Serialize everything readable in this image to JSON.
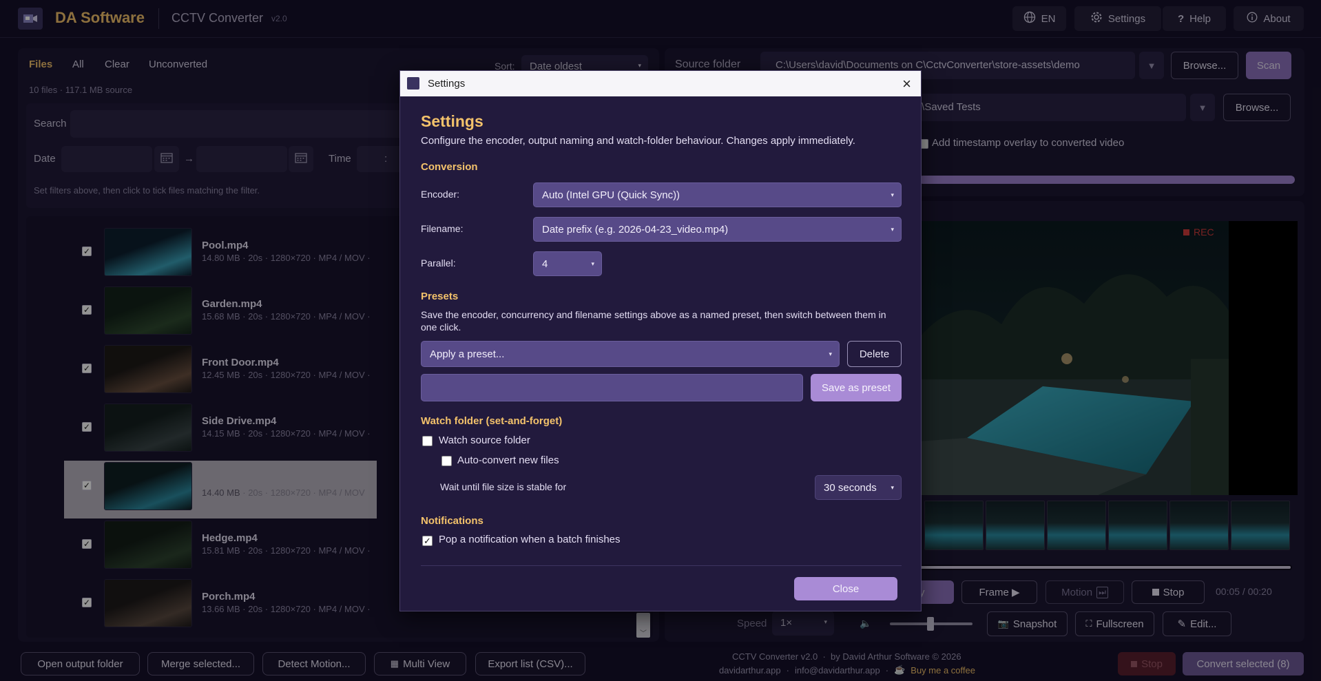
{
  "app": {
    "brand": "DA Software",
    "title": "CCTV Converter",
    "version": "v2.0"
  },
  "topbar": {
    "lang": "EN",
    "settings": "Settings",
    "help": "Help",
    "about": "About"
  },
  "left": {
    "tabs": {
      "files": "Files",
      "all": "All",
      "clear": "Clear",
      "unconverted": "Unconverted"
    },
    "sort_label": "Sort:",
    "sort_value": "Date oldest",
    "summary": "10 files · 117.1 MB source",
    "search_label": "Search",
    "date_label": "Date",
    "arrow": "→",
    "time_label": "Time",
    "time_value": ":",
    "hint": "Set filters above, then click to tick files matching the filter.",
    "files": [
      {
        "name": "Pool.mp4",
        "meta": "14.80 MB · 20s · 1280×720 · MP4 / MOV ·",
        "checked": true,
        "selected": false
      },
      {
        "name": "Garden.mp4",
        "meta": "15.68 MB · 20s · 1280×720 · MP4 / MOV ·",
        "checked": true,
        "selected": false
      },
      {
        "name": "Front Door.mp4",
        "meta": "12.45 MB · 20s · 1280×720 · MP4 / MOV ·",
        "checked": true,
        "selected": false
      },
      {
        "name": "Side Drive.mp4",
        "meta": "14.15 MB · 20s · 1280×720 · MP4 / MOV ·",
        "checked": true,
        "selected": false
      },
      {
        "name": "",
        "meta_size": "14.40 MB",
        "meta": "· 20s · 1280×720 · MP4 / MOV",
        "checked": true,
        "selected": true
      },
      {
        "name": "Hedge.mp4",
        "meta": "15.81 MB · 20s · 1280×720 · MP4 / MOV ·",
        "checked": true,
        "selected": false
      },
      {
        "name": "Porch.mp4",
        "meta": "13.66 MB · 20s · 1280×720 · MP4 / MOV ·",
        "checked": true,
        "selected": false
      }
    ]
  },
  "right": {
    "source_label": "Source folder",
    "source_path": "C:\\Users\\david\\Documents on C\\CctvConverter\\store-assets\\demo",
    "browse": "Browse...",
    "scan": "Scan",
    "output_path_tail": "t\\Saved Tests",
    "timestamp_label": "Add timestamp overlay to converted video",
    "rec": "REC",
    "controls": {
      "play_tail": "y",
      "frame": "Frame ▶",
      "motion": "Motion",
      "stop": "Stop",
      "time": "00:05 / 00:20"
    },
    "speed_label": "Speed",
    "speed_value": "1×",
    "snapshot": "Snapshot",
    "fullscreen": "Fullscreen",
    "edit": "Edit..."
  },
  "bottom": {
    "open_output": "Open output folder",
    "merge": "Merge selected...",
    "detect": "Detect Motion...",
    "multi": "Multi View",
    "export": "Export list (CSV)...",
    "credit1": "CCTV Converter v2.0  ·  by David Arthur Software © 2026",
    "site": "davidarthur.app",
    "email": "info@davidarthur.app",
    "coffee": "Buy me a coffee",
    "stop": "Stop",
    "convert": "Convert selected (8)"
  },
  "dialog": {
    "window_title": "Settings",
    "heading": "Settings",
    "intro": "Configure the encoder, output naming and watch-folder behaviour. Changes apply immediately.",
    "conversion": "Conversion",
    "encoder_label": "Encoder:",
    "encoder_value": "Auto (Intel GPU (Quick Sync))",
    "filename_label": "Filename:",
    "filename_value": "Date prefix (e.g. 2026-04-23_video.mp4)",
    "parallel_label": "Parallel:",
    "parallel_value": "4",
    "presets": "Presets",
    "presets_desc": "Save the encoder, concurrency and filename settings above as a named preset, then switch between them in one click.",
    "apply_preset": "Apply a preset...",
    "delete": "Delete",
    "preset_name_value": "",
    "save_preset": "Save as preset",
    "watch": "Watch folder (set-and-forget)",
    "watch_source": "Watch source folder",
    "auto_convert": "Auto-convert new files",
    "wait_label": "Wait until file size is stable for",
    "wait_value": "30 seconds",
    "notifications": "Notifications",
    "notify_label": "Pop a notification when a batch finishes",
    "close": "Close"
  },
  "colors": {
    "accent": "#a98bd6",
    "heading": "#f3c26b",
    "bg": "#16112a",
    "dialog": "#221a3d"
  }
}
